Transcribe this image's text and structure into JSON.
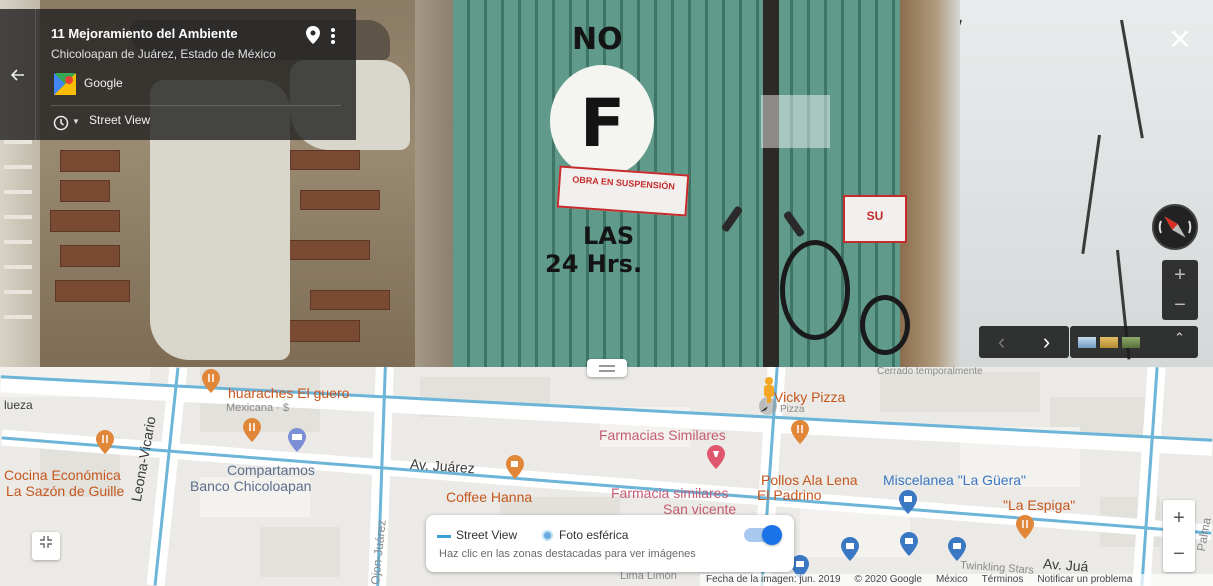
{
  "street_view": {
    "title": "11 Mejoramiento del Ambiente",
    "subtitle": "Chicoloapan de Juárez, Estado de México",
    "provider": "Google",
    "mode": "Street View",
    "scene_text": {
      "no": "NO",
      "f": "F",
      "las": "LAS",
      "hrs": "24 Hrs.",
      "sign": "OBRA EN SUSPENSIÓN",
      "right_sign": "SU"
    },
    "icons": {
      "back": "arrow-left-icon",
      "pin": "location-pin-icon",
      "more": "more-vert-icon",
      "history": "history-icon",
      "close": "close-icon",
      "compass": "compass-icon"
    },
    "zoom": {
      "in": "+",
      "out": "−"
    },
    "nav": {
      "prev": "‹",
      "next": "›"
    }
  },
  "map": {
    "labels": {
      "cerrado": "Cerrado temporalmente",
      "lueza": "lueza",
      "huaraches": "huaraches El guero",
      "huaraches_sub": "Mexicana · $",
      "vicky": "Vicky Pizza",
      "vicky_sub": "Pizza",
      "farmacias": "Farmacias Similares",
      "compartamos1": "Compartamos",
      "compartamos2": "Banco Chicoloapan",
      "av_juarez": "Av. Juárez",
      "coffee": "Coffee Hanna",
      "farmacia2": "Farmacia similares",
      "san_vicente": "San vicente",
      "pollos": "Pollos Ala Lena",
      "padrino": "El Padrino",
      "miscelanea": "Miscelanea \"La Güera\"",
      "espiga": "\"La Espiga\"",
      "cocina1": "Cocina Económica",
      "cocina2": "La Sazón de Guille",
      "leona": "Leona-Vicario",
      "ojon": "Ojon-Juárez",
      "palma": "Palma",
      "lima": "Lima Limón",
      "twinkling": "Twinkling Stars",
      "av_juarez2": "Av. Juá"
    },
    "legend": {
      "street_view": "Street View",
      "sphere": "Foto esférica",
      "hint": "Haz clic en las zonas destacadas para ver imágenes",
      "toggle_on": true
    },
    "zoom": {
      "in": "+",
      "out": "−"
    },
    "collapse_icon": "collapse-icon",
    "footer": {
      "date": "Fecha de la imagen: jun. 2019",
      "copyright": "© 2020 Google",
      "country": "México",
      "terms": "Términos",
      "report": "Notificar un problema"
    }
  },
  "colors": {
    "accent": "#1a73e8",
    "street_view_line": "#6cb4d8",
    "restaurant": "#e0873a",
    "shopping": "#3a78c4",
    "pharmacy": "#e0566e"
  }
}
